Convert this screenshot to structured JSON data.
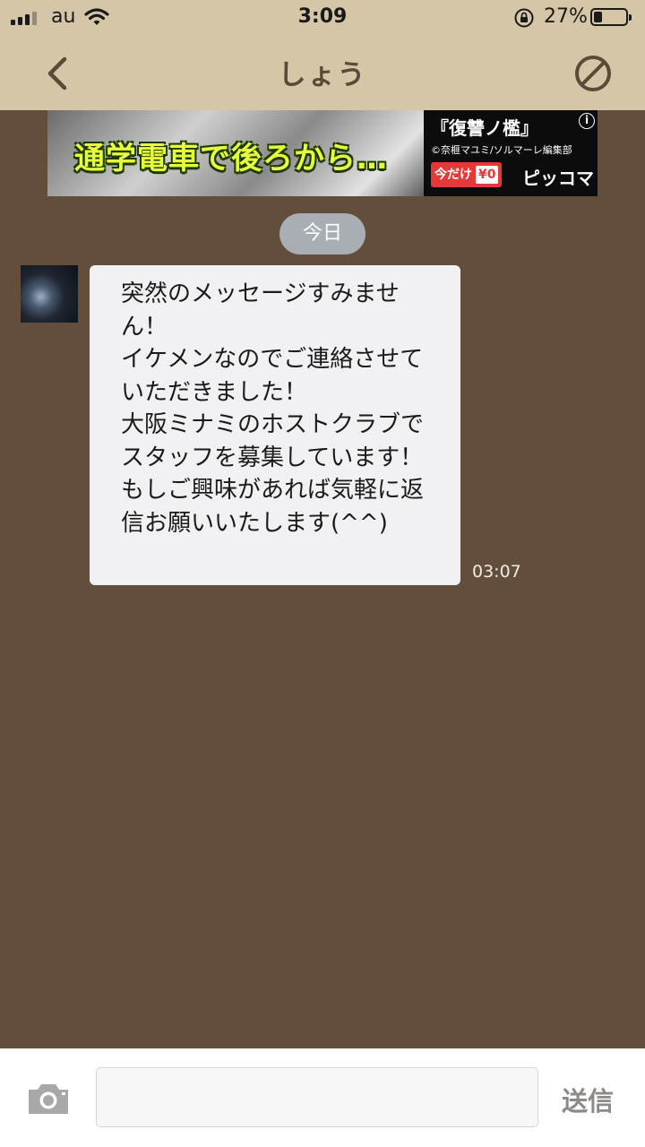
{
  "status_bar": {
    "carrier": "au",
    "time": "3:09",
    "battery_percent": "27%",
    "battery_level": 0.27,
    "icons": [
      "signal-icon",
      "wifi-icon",
      "rotation-lock-icon",
      "battery-icon"
    ]
  },
  "nav": {
    "title": "しょう",
    "back_icon": "chevron-left-icon",
    "block_icon": "block-icon"
  },
  "ad": {
    "headline": "通学電車で後ろから…",
    "title": "『復讐ノ檻』",
    "credit": "©奈榧マユミ/ソルマーレ編集部",
    "price_label": "今だけ",
    "price": "¥0",
    "brand": "ピッコマ",
    "info_icon": "info-icon"
  },
  "chat": {
    "date_label": "今日",
    "messages": [
      {
        "text": "突然のメッセージすみません！\nイケメンなのでご連絡させていただきました！\n大阪ミナミのホストクラブでスタッフを募集しています！\nもしご興味があれば気軽に返信お願いいたします(^^)",
        "time": "03:07"
      }
    ]
  },
  "composer": {
    "placeholder": "",
    "send_label": "送信",
    "camera_icon": "camera-icon"
  },
  "colors": {
    "header_bg": "#d6c6a8",
    "chat_bg": "#624e3b",
    "bubble_bg": "#f1f1f3",
    "date_pill_bg": "#a9aeb4",
    "title_color": "#5a4a38"
  }
}
